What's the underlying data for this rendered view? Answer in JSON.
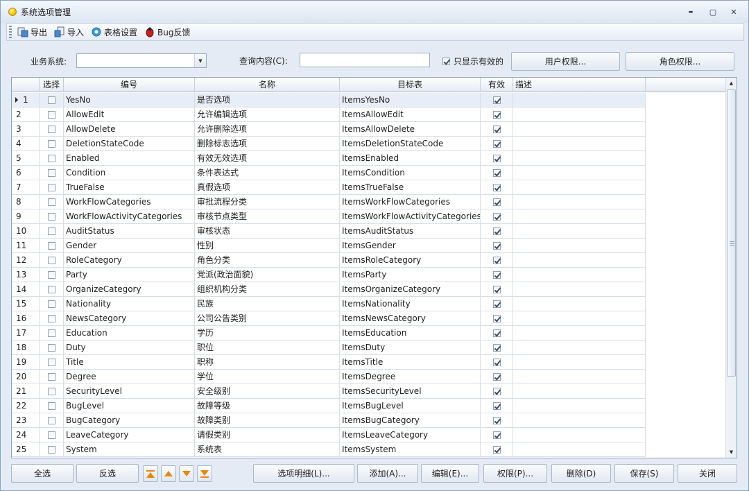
{
  "window": {
    "title": "系统选项管理",
    "minimize": "▬",
    "maximize": "▢",
    "close": "✕"
  },
  "toolbar": {
    "export": "导出",
    "import": "导入",
    "grid_settings": "表格设置",
    "bug_report": "Bug反馈"
  },
  "filters": {
    "system_label": "业务系统:",
    "system_value": "",
    "query_label": "查询内容(C):",
    "query_value": "",
    "only_valid_label": "只显示有效的",
    "only_valid_checked": true,
    "user_perm_button": "用户权限...",
    "role_perm_button": "角色权限..."
  },
  "grid": {
    "columns": [
      "",
      "选择",
      "编号",
      "名称",
      "目标表",
      "有效",
      "描述"
    ],
    "rows": [
      {
        "no": "1",
        "code": "YesNo",
        "name": "是否选项",
        "table": "ItemsYesNo",
        "valid": true
      },
      {
        "no": "2",
        "code": "AllowEdit",
        "name": "允许编辑选项",
        "table": "ItemsAllowEdit",
        "valid": true
      },
      {
        "no": "3",
        "code": "AllowDelete",
        "name": "允许删除选项",
        "table": "ItemsAllowDelete",
        "valid": true
      },
      {
        "no": "4",
        "code": "DeletionStateCode",
        "name": "删除标志选项",
        "table": "ItemsDeletionStateCode",
        "valid": true
      },
      {
        "no": "5",
        "code": "Enabled",
        "name": "有效无效选项",
        "table": "ItemsEnabled",
        "valid": true
      },
      {
        "no": "6",
        "code": "Condition",
        "name": "条件表达式",
        "table": "ItemsCondition",
        "valid": true
      },
      {
        "no": "7",
        "code": "TrueFalse",
        "name": "真假选项",
        "table": "ItemsTrueFalse",
        "valid": true
      },
      {
        "no": "8",
        "code": "WorkFlowCategories",
        "name": "审批流程分类",
        "table": "ItemsWorkFlowCategories",
        "valid": true
      },
      {
        "no": "9",
        "code": "WorkFlowActivityCategories",
        "name": "审核节点类型",
        "table": "ItemsWorkFlowActivityCategories",
        "valid": true
      },
      {
        "no": "10",
        "code": "AuditStatus",
        "name": "审核状态",
        "table": "ItemsAuditStatus",
        "valid": true
      },
      {
        "no": "11",
        "code": "Gender",
        "name": "性别",
        "table": "ItemsGender",
        "valid": true
      },
      {
        "no": "12",
        "code": "RoleCategory",
        "name": "角色分类",
        "table": "ItemsRoleCategory",
        "valid": true
      },
      {
        "no": "13",
        "code": "Party",
        "name": "党派(政治面貌)",
        "table": "ItemsParty",
        "valid": true
      },
      {
        "no": "14",
        "code": "OrganizeCategory",
        "name": "组织机构分类",
        "table": "ItemsOrganizeCategory",
        "valid": true
      },
      {
        "no": "15",
        "code": "Nationality",
        "name": "民族",
        "table": "ItemsNationality",
        "valid": true
      },
      {
        "no": "16",
        "code": "NewsCategory",
        "name": "公司公告类别",
        "table": "ItemsNewsCategory",
        "valid": true
      },
      {
        "no": "17",
        "code": "Education",
        "name": "学历",
        "table": "ItemsEducation",
        "valid": true
      },
      {
        "no": "18",
        "code": "Duty",
        "name": "职位",
        "table": "ItemsDuty",
        "valid": true
      },
      {
        "no": "19",
        "code": "Title",
        "name": "职称",
        "table": "ItemsTitle",
        "valid": true
      },
      {
        "no": "20",
        "code": "Degree",
        "name": "学位",
        "table": "ItemsDegree",
        "valid": true
      },
      {
        "no": "21",
        "code": "SecurityLevel",
        "name": "安全级别",
        "table": "ItemsSecurityLevel",
        "valid": true
      },
      {
        "no": "22",
        "code": "BugLevel",
        "name": "故障等级",
        "table": "ItemsBugLevel",
        "valid": true
      },
      {
        "no": "23",
        "code": "BugCategory",
        "name": "故障类别",
        "table": "ItemsBugCategory",
        "valid": true
      },
      {
        "no": "24",
        "code": "LeaveCategory",
        "name": "请假类别",
        "table": "ItemsLeaveCategory",
        "valid": true
      },
      {
        "no": "25",
        "code": "System",
        "name": "系统表",
        "table": "ItemsSystem",
        "valid": true
      }
    ]
  },
  "bottom": {
    "select_all": "全选",
    "invert": "反选",
    "option_detail": "选项明细(L)...",
    "add": "添加(A)...",
    "edit": "编辑(E)...",
    "permission": "权限(P)...",
    "delete": "删除(D)",
    "save": "保存(S)",
    "close": "关闭"
  }
}
